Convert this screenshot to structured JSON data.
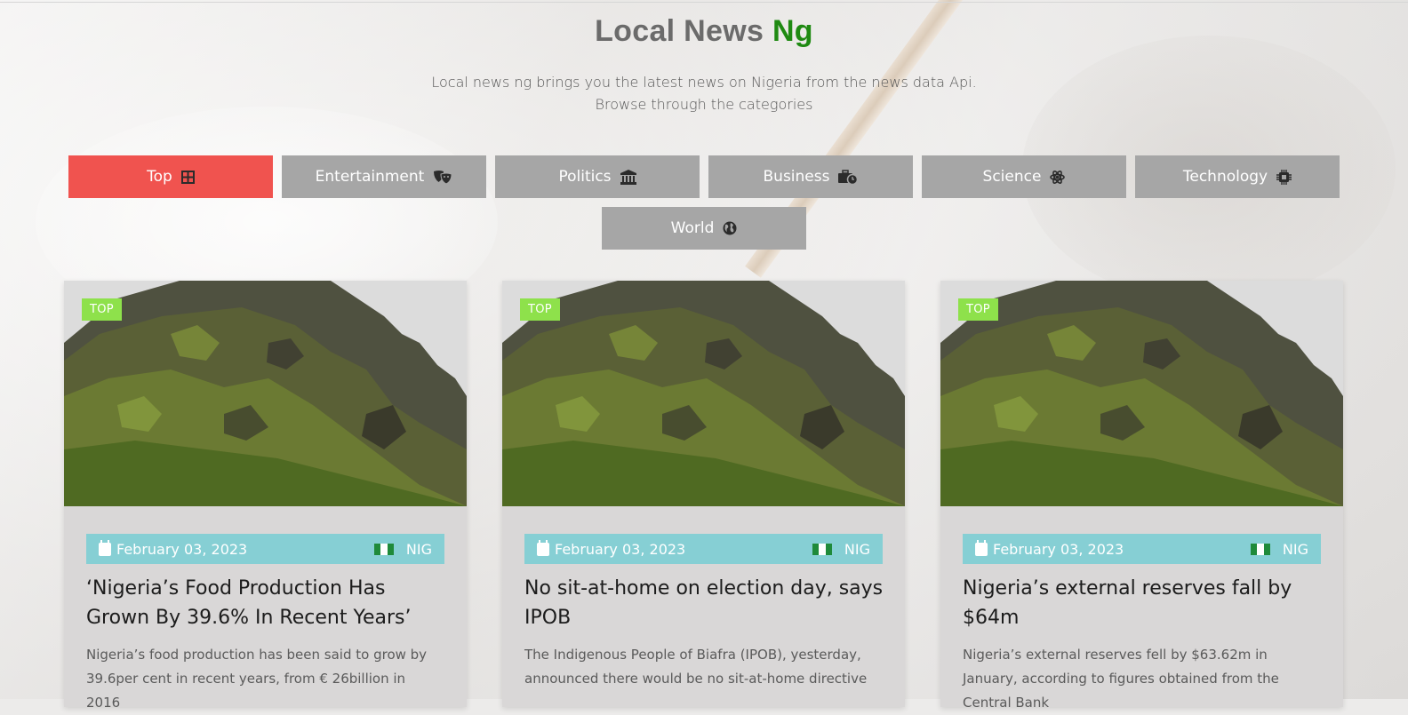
{
  "header": {
    "title_main": "Local News",
    "title_accent": "Ng",
    "tagline_line1": "Local news ng brings you the latest news on Nigeria from the news data Api.",
    "tagline_line2": "Browse through the categories"
  },
  "categories": [
    {
      "label": "Top",
      "icon": "grid-icon",
      "active": true
    },
    {
      "label": "Entertainment",
      "icon": "masks-icon",
      "active": false
    },
    {
      "label": "Politics",
      "icon": "bank-icon",
      "active": false
    },
    {
      "label": "Business",
      "icon": "briefcase-clock-icon",
      "active": false
    },
    {
      "label": "Science",
      "icon": "atom-icon",
      "active": false
    },
    {
      "label": "Technology",
      "icon": "chip-icon",
      "active": false
    },
    {
      "label": "World",
      "icon": "globe-icon",
      "active": false
    }
  ],
  "colors": {
    "active_category": "#f0534f",
    "inactive_category": "#a6a6a6",
    "title_accent": "#1f8a12",
    "tag": "#8ee14b",
    "meta_bar": "#86cfd4"
  },
  "articles": [
    {
      "tag": "TOP",
      "date": "February 03, 2023",
      "country": "NIG",
      "title": "‘Nigeria’s Food Production Has Grown By 39.6% In Recent Years’",
      "description": "Nigeria’s food production has been said to grow by 39.6per cent in recent years, from € 26billion in 2016"
    },
    {
      "tag": "TOP",
      "date": "February 03, 2023",
      "country": "NIG",
      "title": "No sit-at-home on election day, says IPOB",
      "description": "The Indigenous People of Biafra (IPOB), yesterday, announced there would be no sit-at-home directive"
    },
    {
      "tag": "TOP",
      "date": "February 03, 2023",
      "country": "NIG",
      "title": "Nigeria’s external reserves fall by $64m",
      "description": "Nigeria’s external reserves fell by $63.62m in January, according to figures obtained from the Central Bank"
    }
  ]
}
